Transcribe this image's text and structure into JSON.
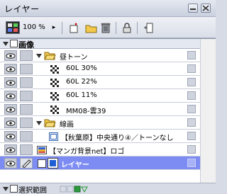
{
  "window": {
    "title": "レイヤー"
  },
  "toolbar": {
    "zoom_value": "100 %",
    "zoom_arrow": "▸"
  },
  "group": {
    "label": "画像"
  },
  "layers": [
    {
      "name": "昼トーン"
    },
    {
      "name": "60L 30%"
    },
    {
      "name": "60L 22%"
    },
    {
      "name": "60L 11%"
    },
    {
      "name": "MM08-雲39"
    },
    {
      "name": "線画"
    },
    {
      "name": "【秋葉原】中央通り④／トーンなし"
    },
    {
      "name": "【マンガ背景net】ロゴ"
    },
    {
      "name": "レイヤー"
    }
  ],
  "status": {
    "label": "選択範囲"
  },
  "colors": {
    "selected_row": "#7d8cf2",
    "folder": "#f2c94c",
    "blue_square": "#1f5fd6"
  }
}
